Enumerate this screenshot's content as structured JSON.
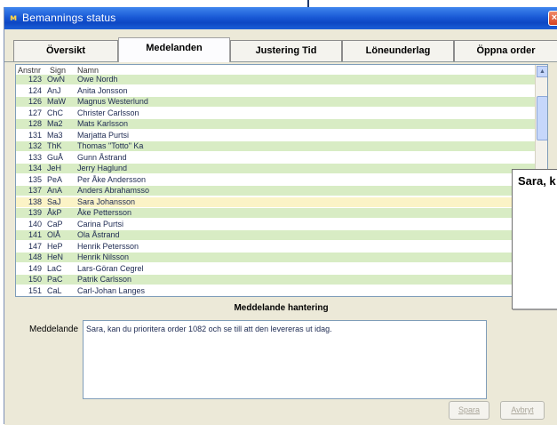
{
  "window": {
    "title": "Bemannings status",
    "icon": "app-logo-icon",
    "close_label": "×"
  },
  "tabs": [
    {
      "label": "Översikt",
      "active": false
    },
    {
      "label": "Medelanden",
      "active": true
    },
    {
      "label": "Justering Tid",
      "active": false
    },
    {
      "label": "Löneunderlag",
      "active": false
    },
    {
      "label": "Öppna order",
      "active": false
    }
  ],
  "list": {
    "columns": {
      "nr": "Anstnr",
      "sign": "Sign",
      "name": "Namn"
    },
    "rows": [
      {
        "nr": "123",
        "sign": "OwN",
        "name": "Owe Nordh",
        "color": "green"
      },
      {
        "nr": "124",
        "sign": "AnJ",
        "name": "Anita Jonsson",
        "color": "white"
      },
      {
        "nr": "126",
        "sign": "MaW",
        "name": "Magnus Westerlund",
        "color": "green"
      },
      {
        "nr": "127",
        "sign": "ChC",
        "name": "Christer Carlsson",
        "color": "white"
      },
      {
        "nr": "128",
        "sign": "Ma2",
        "name": "Mats Karlsson",
        "color": "green"
      },
      {
        "nr": "131",
        "sign": "Ma3",
        "name": "Marjatta Purtsi",
        "color": "white"
      },
      {
        "nr": "132",
        "sign": "ThK",
        "name": "Thomas \"Totto\" Ka",
        "color": "green"
      },
      {
        "nr": "133",
        "sign": "GuÅ",
        "name": "Gunn Åstrand",
        "color": "white"
      },
      {
        "nr": "134",
        "sign": "JeH",
        "name": "Jerry Haglund",
        "color": "green"
      },
      {
        "nr": "135",
        "sign": "PeA",
        "name": "Per Åke Andersson",
        "color": "white"
      },
      {
        "nr": "137",
        "sign": "AnA",
        "name": "Anders Abrahamsso",
        "color": "green"
      },
      {
        "nr": "138",
        "sign": "SaJ",
        "name": "Sara Johansson",
        "color": "yellow"
      },
      {
        "nr": "139",
        "sign": "ÅkP",
        "name": "Åke Pettersson",
        "color": "green"
      },
      {
        "nr": "140",
        "sign": "CaP",
        "name": "Carina Purtsi",
        "color": "white"
      },
      {
        "nr": "141",
        "sign": "OlÅ",
        "name": "Ola Åstrand",
        "color": "green"
      },
      {
        "nr": "147",
        "sign": "HeP",
        "name": "Henrik Petersson",
        "color": "white"
      },
      {
        "nr": "148",
        "sign": "HeN",
        "name": "Henrik Nilsson",
        "color": "green"
      },
      {
        "nr": "149",
        "sign": "LaC",
        "name": "Lars-Göran Cegrel",
        "color": "white"
      },
      {
        "nr": "150",
        "sign": "PaC",
        "name": "Patrik Carlsson",
        "color": "green"
      },
      {
        "nr": "151",
        "sign": "CaL",
        "name": "Carl-Johan Langes",
        "color": "white"
      }
    ]
  },
  "message_section": {
    "title": "Meddelande hantering",
    "label": "Meddelande",
    "text": "Sara, kan du prioritera order 1082 och se till att den levereras ut idag."
  },
  "buttons": {
    "save": "Spara",
    "cancel": "Avbryt"
  },
  "popup": {
    "text": "Sara, k"
  },
  "colors": {
    "title_bar": "#1a5ad6",
    "row_green": "#d8ecc4",
    "row_selected": "#fbf3c6"
  }
}
